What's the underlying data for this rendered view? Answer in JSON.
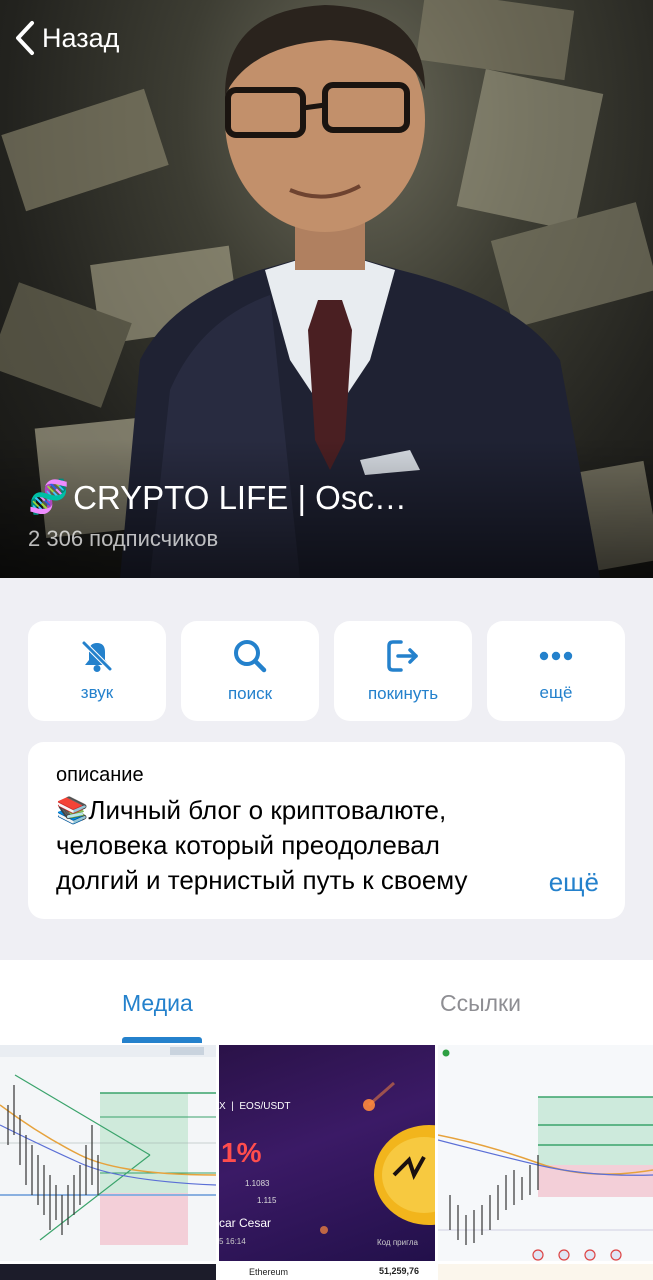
{
  "nav": {
    "back_label": "Назад"
  },
  "channel": {
    "emoji": "🧬",
    "name": "CRYPTO LIFE | Osc…",
    "subscribers": "2 306 подписчиков"
  },
  "actions": [
    {
      "label": "звук",
      "icon": "bell-slash-icon"
    },
    {
      "label": "поиск",
      "icon": "search-icon"
    },
    {
      "label": "покинуть",
      "icon": "leave-icon"
    },
    {
      "label": "ещё",
      "icon": "more-dots-icon"
    }
  ],
  "description": {
    "label": "описание",
    "emoji": "📚",
    "line1": "Личный блог о криптовалюте,",
    "line2": "человека который преодолевал",
    "line3": "долгий и тернистый путь к своему",
    "more": "ещё"
  },
  "tabs": [
    {
      "label": "Медиа",
      "active": true
    },
    {
      "label": "Ссылки",
      "active": false
    }
  ],
  "media": {
    "thumb2": {
      "pair": "EOS/USDT",
      "percent": "1%",
      "num1": "1.1083",
      "num2": "1.115",
      "name": "car Cesar",
      "time": "5 16:14",
      "footer": "Код пригла"
    },
    "thumb5": {
      "coin": "Ethereum",
      "price": "51,259,76"
    }
  },
  "colors": {
    "accent": "#2481cc",
    "background": "#efeff4",
    "card": "#ffffff"
  }
}
